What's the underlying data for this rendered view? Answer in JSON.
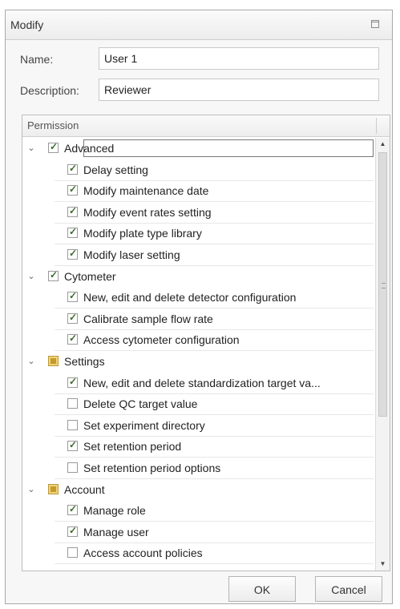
{
  "window": {
    "title": "Modify"
  },
  "form": {
    "name_label": "Name:",
    "name_value": "User 1",
    "description_label": "Description:",
    "description_value": "Reviewer"
  },
  "permissions": {
    "header": "Permission",
    "items": [
      {
        "label": "Advanced",
        "level": 0,
        "state": "checked",
        "expanded": true,
        "focused": true
      },
      {
        "label": "Delay setting",
        "level": 1,
        "state": "checked"
      },
      {
        "label": "Modify maintenance date",
        "level": 1,
        "state": "checked"
      },
      {
        "label": "Modify event rates setting",
        "level": 1,
        "state": "checked"
      },
      {
        "label": "Modify plate type library",
        "level": 1,
        "state": "checked"
      },
      {
        "label": "Modify laser setting",
        "level": 1,
        "state": "checked"
      },
      {
        "label": "Cytometer",
        "level": 0,
        "state": "checked",
        "expanded": true
      },
      {
        "label": "New, edit and delete detector configuration",
        "level": 1,
        "state": "checked"
      },
      {
        "label": "Calibrate sample flow rate",
        "level": 1,
        "state": "checked"
      },
      {
        "label": "Access cytometer configuration",
        "level": 1,
        "state": "checked"
      },
      {
        "label": "Settings",
        "level": 0,
        "state": "partial",
        "expanded": true
      },
      {
        "label": "New, edit and delete standardization target va...",
        "level": 1,
        "state": "checked"
      },
      {
        "label": "Delete QC target value",
        "level": 1,
        "state": "unchecked"
      },
      {
        "label": "Set experiment directory",
        "level": 1,
        "state": "unchecked"
      },
      {
        "label": "Set retention period",
        "level": 1,
        "state": "checked"
      },
      {
        "label": "Set retention period options",
        "level": 1,
        "state": "unchecked"
      },
      {
        "label": "Account",
        "level": 0,
        "state": "partial",
        "expanded": true
      },
      {
        "label": "Manage role",
        "level": 1,
        "state": "checked"
      },
      {
        "label": "Manage user",
        "level": 1,
        "state": "checked"
      },
      {
        "label": "Access account policies",
        "level": 1,
        "state": "unchecked"
      }
    ]
  },
  "buttons": {
    "ok": "OK",
    "cancel": "Cancel"
  }
}
